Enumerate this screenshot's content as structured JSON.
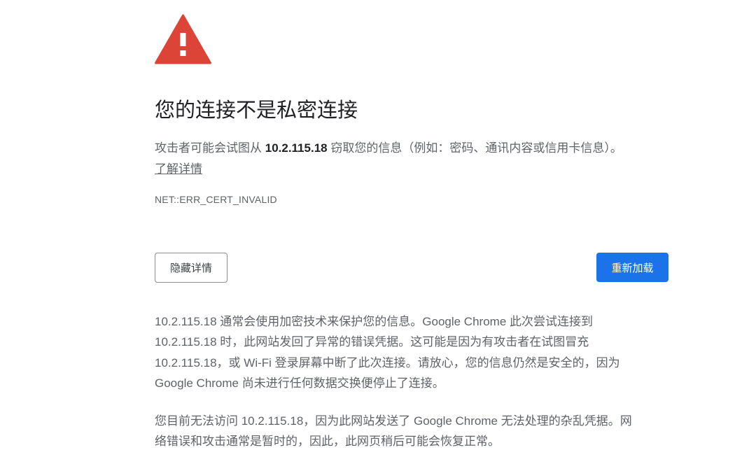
{
  "warning": {
    "icon": "warning-triangle-icon",
    "color": "#db4437"
  },
  "title": "您的连接不是私密连接",
  "description": {
    "before": "攻击者可能会试图从 ",
    "host": "10.2.115.18",
    "after": " 窃取您的信息（例如：密码、通讯内容或信用卡信息）。"
  },
  "learn_more": "了解详情",
  "error_code": "NET::ERR_CERT_INVALID",
  "buttons": {
    "hide_details": "隐藏详情",
    "reload": "重新加载",
    "reload_color": "#1a73e8"
  },
  "details": {
    "paragraph1_lines": [
      "10.2.115.18 通常会使用加密技术来保护您的信息。Google Chrome 此次尝试连接到",
      "10.2.115.18 时，此网站发回了异常的错误凭据。这可能是因为有攻击者在试图冒充",
      "10.2.115.18，或 Wi-Fi 登录屏幕中断了此次连接。请放心，您的信息仍然是安全的，因为",
      "Google Chrome 尚未进行任何数据交换便停止了连接。"
    ],
    "paragraph2_lines": [
      "您目前无法访问 10.2.115.18，因为此网站发送了 Google Chrome 无法处理的杂乱凭据。网",
      "络错误和攻击通常是暂时的，因此，此网页稍后可能会恢复正常。"
    ]
  }
}
